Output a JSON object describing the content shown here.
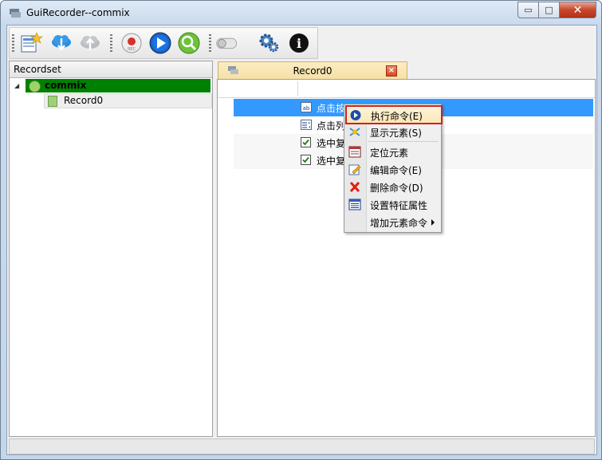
{
  "window": {
    "title": "GuiRecorder--commix"
  },
  "caption_buttons": {
    "minimize": "▭",
    "maximize": "□",
    "close": "✕"
  },
  "toolbar": {
    "buttons": [
      {
        "name": "new-record-icon"
      },
      {
        "name": "cloud-download-icon"
      },
      {
        "name": "cloud-upload-icon"
      },
      {
        "name": "record-icon",
        "label": "REC"
      },
      {
        "name": "play-icon"
      },
      {
        "name": "search-element-icon"
      },
      {
        "name": "toggle-icon"
      },
      {
        "name": "settings-icon"
      },
      {
        "name": "info-icon",
        "label": "i"
      }
    ]
  },
  "left_panel": {
    "header": "Recordset",
    "tree": {
      "root": {
        "label": "commix",
        "expander": "◢"
      },
      "child": {
        "label": "Record0"
      }
    }
  },
  "tab": {
    "label": "Record0",
    "close": "×"
  },
  "grid": {
    "rows": [
      {
        "icon": "textbox-icon",
        "text": "点击按"
      },
      {
        "icon": "list-icon",
        "text": "点击列"
      },
      {
        "icon": "checkbox-icon",
        "text": "选中复"
      },
      {
        "icon": "checkbox-icon",
        "text": "选中复"
      }
    ]
  },
  "context_menu": {
    "items": [
      {
        "label": "执行命令(E)",
        "icon": "execute-icon"
      },
      {
        "label": "显示元素(S)",
        "icon": "show-element-icon"
      },
      {
        "label": "定位元素",
        "icon": "locate-element-icon"
      },
      {
        "label": "编辑命令(E)",
        "icon": "edit-icon"
      },
      {
        "label": "删除命令(D)",
        "icon": "delete-icon"
      },
      {
        "label": "设置特征属性",
        "icon": "properties-icon"
      },
      {
        "label": "增加元素命令",
        "icon": ""
      }
    ]
  },
  "colors": {
    "selection": "#3399ff",
    "tree_highlight": "#008000",
    "menu_highlight_border": "#d02020"
  }
}
